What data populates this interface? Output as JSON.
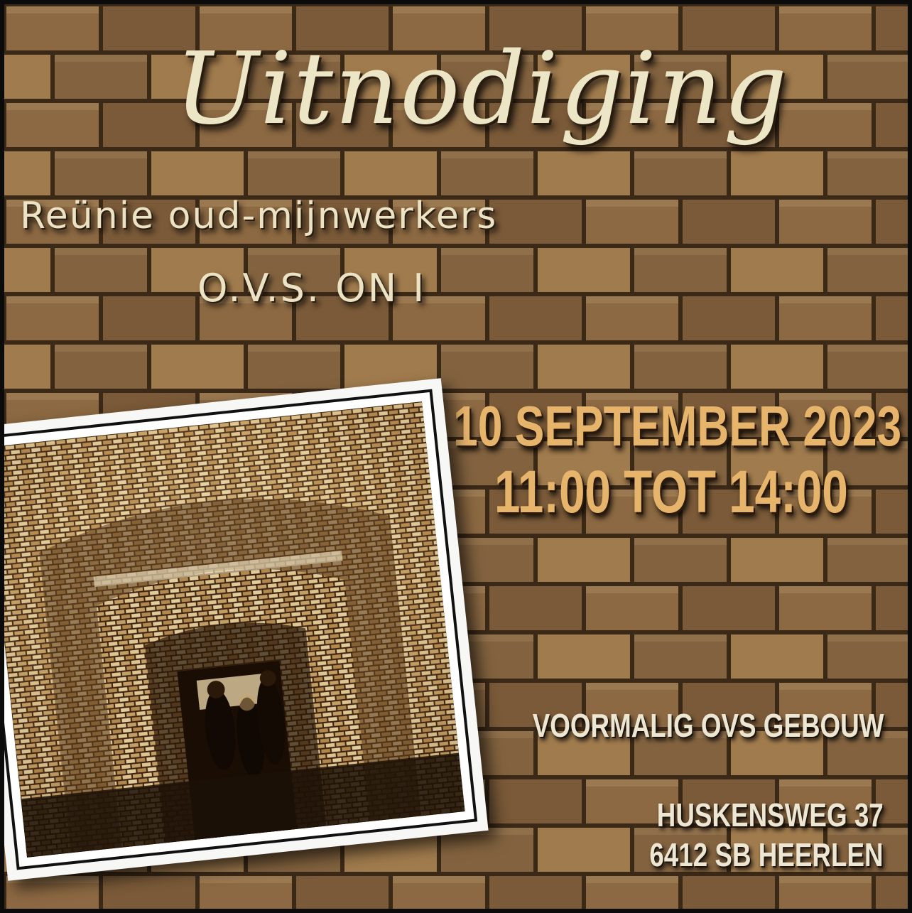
{
  "invitation": {
    "title": "Uitnodiging",
    "subtitle_line1": "Reünie oud-mijnwerkers",
    "subtitle_line2": "O.V.S. ON I",
    "date": "10 SEPTEMBER 2023",
    "time": "11:00 TOT 14:00",
    "location_name": "VOORMALIG OVS GEBOUW",
    "address_street": "HUSKENSWEG 37",
    "address_city": "6412 SB HEERLEN"
  },
  "colors": {
    "brick": "#7e5f3f",
    "mortar": "#3c2a19",
    "title_text": "#ede6c6",
    "date_text": "#e7b46c",
    "address_text": "#ece6d2",
    "photo_border": "#f7f7f5"
  },
  "photo": {
    "icon": "sepia-photo-tunnel-with-miners"
  }
}
